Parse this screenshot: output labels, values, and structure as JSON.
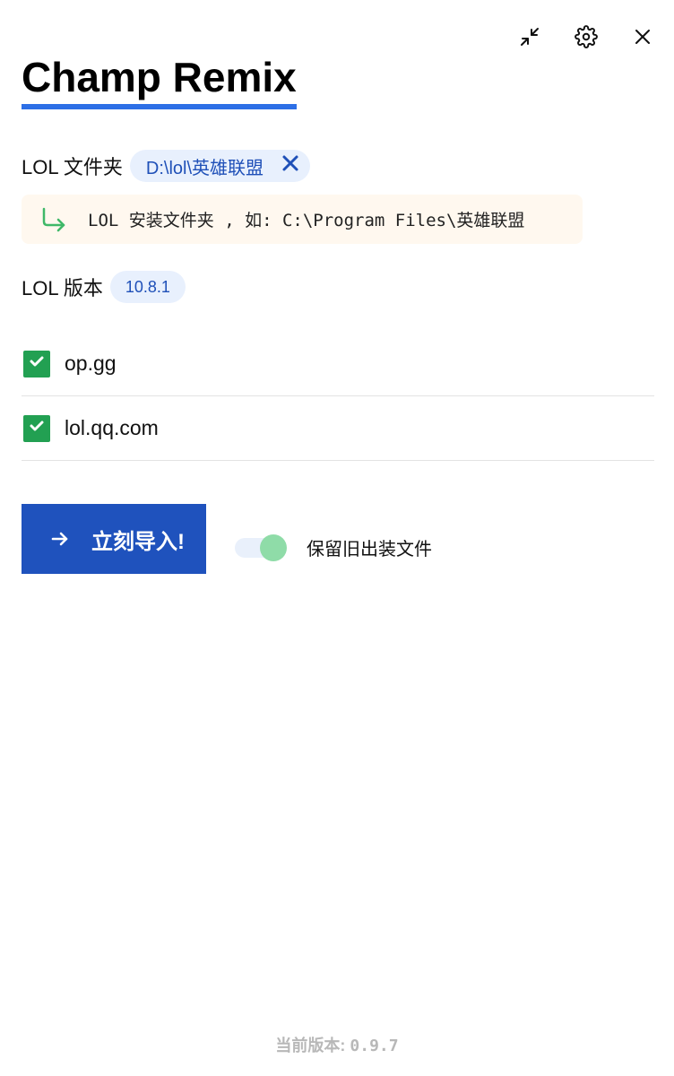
{
  "app": {
    "title": "Champ Remix"
  },
  "window_controls": {
    "icons": [
      "minimize-icon",
      "gear-icon",
      "close-icon"
    ]
  },
  "folder": {
    "label": "LOL 文件夹",
    "value": "D:\\lol\\英雄联盟",
    "hint": "LOL 安装文件夹 , 如: C:\\Program Files\\英雄联盟"
  },
  "version": {
    "label": "LOL 版本",
    "value": "10.8.1"
  },
  "sources": [
    {
      "label": "op.gg",
      "checked": true
    },
    {
      "label": "lol.qq.com",
      "checked": true
    }
  ],
  "actions": {
    "import_label": "立刻导入!",
    "keep_old_label": "保留旧出装文件",
    "keep_old_enabled": true
  },
  "footer": {
    "label": "当前版本:",
    "version": "0.9.7"
  },
  "colors": {
    "accent": "#2d6fe6",
    "button": "#1f52bd",
    "chip_bg": "#e8f0fd",
    "chip_text": "#1f50b8",
    "check": "#22a052",
    "hint_bg": "#fff8ef",
    "toggle_knob": "#8fdca8"
  }
}
